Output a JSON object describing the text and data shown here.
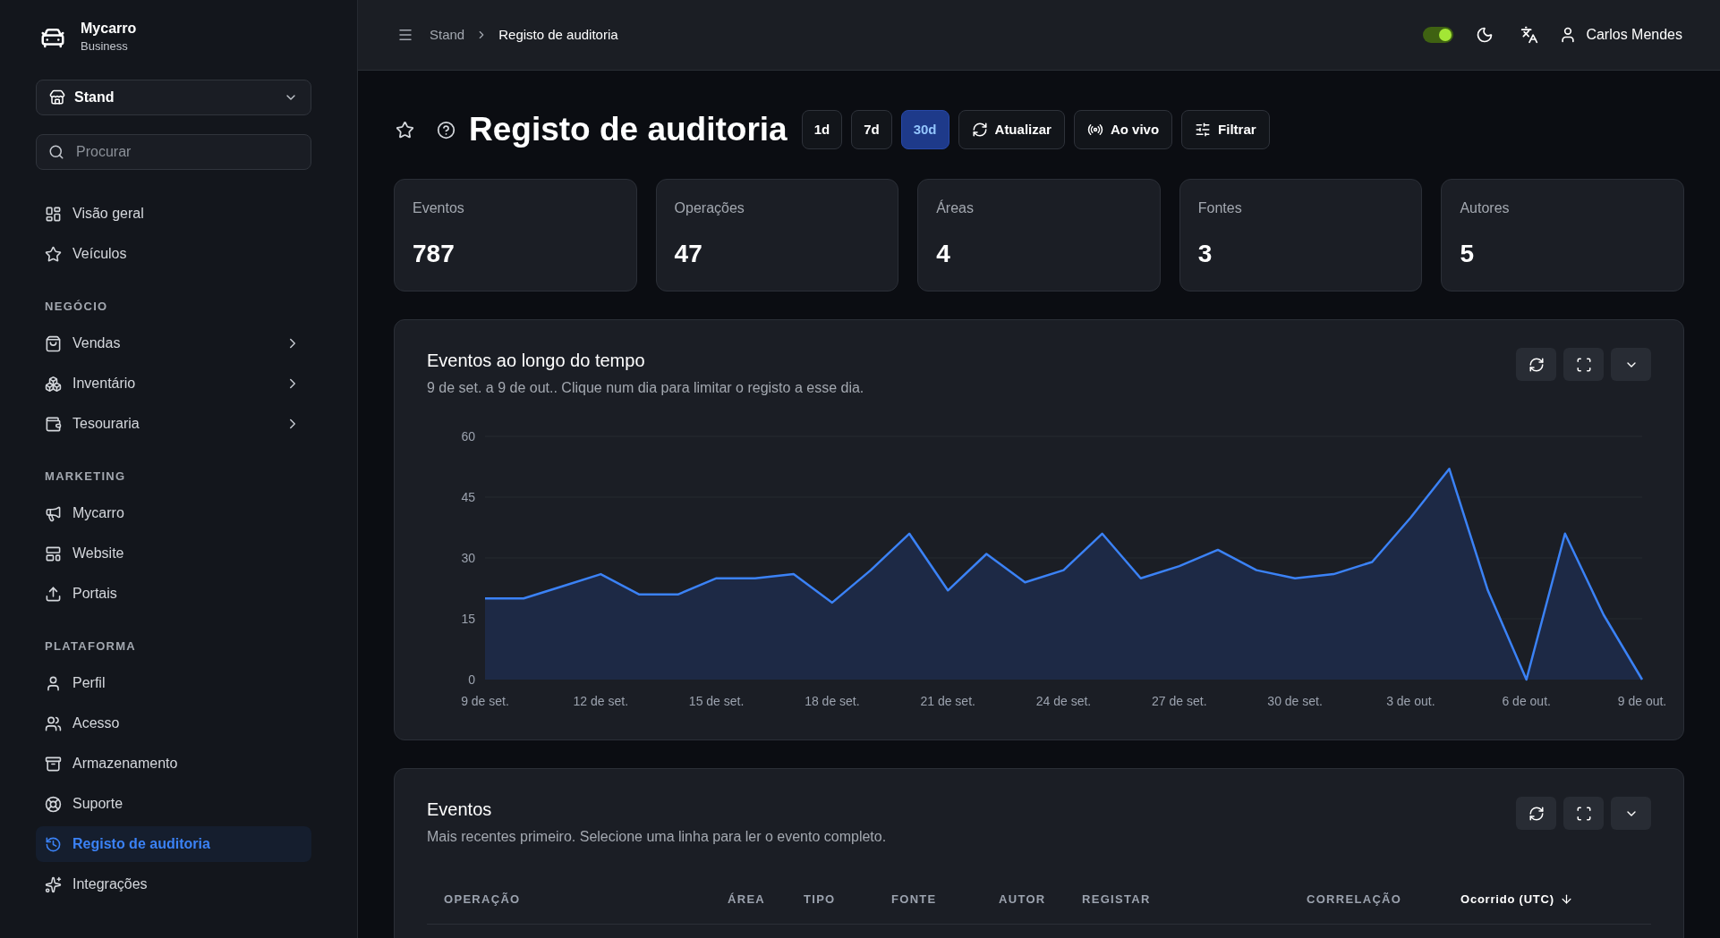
{
  "sidebar": {
    "brand": {
      "name": "Mycarro",
      "subtitle": "Business"
    },
    "workspace_select": {
      "value": "Stand"
    },
    "search": {
      "placeholder": "Procurar"
    },
    "sections": [
      {
        "items": [
          {
            "label": "Visão geral",
            "selected": false
          },
          {
            "label": "Veículos",
            "selected": false
          }
        ]
      },
      {
        "title": "NEGÓCIO",
        "items": [
          {
            "label": "Vendas",
            "selected": false,
            "expanded": false
          },
          {
            "label": "Inventário",
            "selected": false,
            "expanded": false
          },
          {
            "label": "Tesouraria",
            "selected": false,
            "expanded": false
          }
        ]
      },
      {
        "title": "MARKETING",
        "items": [
          {
            "label": "Mycarro",
            "selected": false
          },
          {
            "label": "Website",
            "selected": false
          },
          {
            "label": "Portais",
            "selected": false
          }
        ]
      },
      {
        "title": "PLATAFORMA",
        "items": [
          {
            "label": "Perfil",
            "selected": false
          },
          {
            "label": "Acesso",
            "selected": false
          },
          {
            "label": "Armazenamento",
            "selected": false
          },
          {
            "label": "Suporte",
            "selected": false
          },
          {
            "label": "Registo de auditoria",
            "selected": true
          },
          {
            "label": "Integrações",
            "selected": false
          }
        ]
      }
    ]
  },
  "header": {
    "breadcrumb": [
      {
        "label": "Stand",
        "current": false
      },
      {
        "label": "Registo de auditoria",
        "current": true
      }
    ],
    "toggle": {
      "on": true
    },
    "user": {
      "name": "Carlos Mendes"
    }
  },
  "page": {
    "title": "Registo de auditoria",
    "favorite": false,
    "periods": [
      {
        "label": "1d",
        "selected": false
      },
      {
        "label": "7d",
        "selected": false
      },
      {
        "label": "30d",
        "selected": true
      }
    ],
    "actions": [
      {
        "label": "Atualizar"
      },
      {
        "label": "Ao vivo"
      },
      {
        "label": "Filtrar"
      }
    ]
  },
  "stats": [
    {
      "label": "Eventos",
      "value": "787"
    },
    {
      "label": "Operações",
      "value": "47"
    },
    {
      "label": "Áreas",
      "value": "4"
    },
    {
      "label": "Fontes",
      "value": "3"
    },
    {
      "label": "Autores",
      "value": "5"
    }
  ],
  "timeline_card": {
    "title": "Eventos ao longo do tempo",
    "subtitle": "9 de set. a 9 de out.. Clique num dia para limitar o registo a esse dia.",
    "chart_data": {
      "type": "area",
      "categories": [
        "9 de set.",
        null,
        null,
        "12 de set.",
        null,
        null,
        "15 de set.",
        null,
        null,
        "18 de set.",
        null,
        null,
        "21 de set.",
        null,
        null,
        "24 de set.",
        null,
        null,
        "27 de set.",
        null,
        null,
        "30 de set.",
        null,
        null,
        "3 de out.",
        null,
        null,
        "6 de out.",
        null,
        null,
        "9 de out."
      ],
      "values": [
        20,
        20,
        23,
        26,
        21,
        21,
        25,
        25,
        26,
        19,
        27,
        36,
        22,
        31,
        24,
        27,
        36,
        25,
        28,
        32,
        27,
        25,
        26,
        29,
        40,
        52,
        22,
        0,
        36,
        16,
        0
      ],
      "ylim": [
        0,
        60
      ],
      "yticks": [
        0,
        15,
        30,
        45,
        60
      ],
      "grid": true
    }
  },
  "events_table": {
    "title": "Eventos",
    "subtitle": "Mais recentes primeiro. Selecione uma linha para ler o evento completo.",
    "columns": [
      {
        "label": "OPERAÇÃO",
        "sorted": false
      },
      {
        "label": "ÁREA",
        "sorted": false
      },
      {
        "label": "TIPO",
        "sorted": false
      },
      {
        "label": "FONTE",
        "sorted": false
      },
      {
        "label": "AUTOR",
        "sorted": false
      },
      {
        "label": "REGISTAR",
        "sorted": false
      },
      {
        "label": "CORRELAÇÃO",
        "sorted": false
      },
      {
        "label": "Ocorrido (UTC)",
        "sorted": true
      }
    ]
  }
}
